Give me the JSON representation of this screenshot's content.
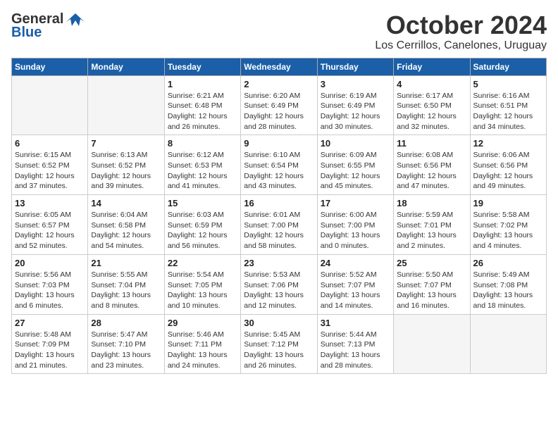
{
  "header": {
    "logo_general": "General",
    "logo_blue": "Blue",
    "title": "October 2024",
    "subtitle": "Los Cerrillos, Canelones, Uruguay"
  },
  "days_of_week": [
    "Sunday",
    "Monday",
    "Tuesday",
    "Wednesday",
    "Thursday",
    "Friday",
    "Saturday"
  ],
  "weeks": [
    [
      {
        "day": "",
        "content": ""
      },
      {
        "day": "",
        "content": ""
      },
      {
        "day": "1",
        "content": "Sunrise: 6:21 AM\nSunset: 6:48 PM\nDaylight: 12 hours and 26 minutes."
      },
      {
        "day": "2",
        "content": "Sunrise: 6:20 AM\nSunset: 6:49 PM\nDaylight: 12 hours and 28 minutes."
      },
      {
        "day": "3",
        "content": "Sunrise: 6:19 AM\nSunset: 6:49 PM\nDaylight: 12 hours and 30 minutes."
      },
      {
        "day": "4",
        "content": "Sunrise: 6:17 AM\nSunset: 6:50 PM\nDaylight: 12 hours and 32 minutes."
      },
      {
        "day": "5",
        "content": "Sunrise: 6:16 AM\nSunset: 6:51 PM\nDaylight: 12 hours and 34 minutes."
      }
    ],
    [
      {
        "day": "6",
        "content": "Sunrise: 6:15 AM\nSunset: 6:52 PM\nDaylight: 12 hours and 37 minutes."
      },
      {
        "day": "7",
        "content": "Sunrise: 6:13 AM\nSunset: 6:52 PM\nDaylight: 12 hours and 39 minutes."
      },
      {
        "day": "8",
        "content": "Sunrise: 6:12 AM\nSunset: 6:53 PM\nDaylight: 12 hours and 41 minutes."
      },
      {
        "day": "9",
        "content": "Sunrise: 6:10 AM\nSunset: 6:54 PM\nDaylight: 12 hours and 43 minutes."
      },
      {
        "day": "10",
        "content": "Sunrise: 6:09 AM\nSunset: 6:55 PM\nDaylight: 12 hours and 45 minutes."
      },
      {
        "day": "11",
        "content": "Sunrise: 6:08 AM\nSunset: 6:56 PM\nDaylight: 12 hours and 47 minutes."
      },
      {
        "day": "12",
        "content": "Sunrise: 6:06 AM\nSunset: 6:56 PM\nDaylight: 12 hours and 49 minutes."
      }
    ],
    [
      {
        "day": "13",
        "content": "Sunrise: 6:05 AM\nSunset: 6:57 PM\nDaylight: 12 hours and 52 minutes."
      },
      {
        "day": "14",
        "content": "Sunrise: 6:04 AM\nSunset: 6:58 PM\nDaylight: 12 hours and 54 minutes."
      },
      {
        "day": "15",
        "content": "Sunrise: 6:03 AM\nSunset: 6:59 PM\nDaylight: 12 hours and 56 minutes."
      },
      {
        "day": "16",
        "content": "Sunrise: 6:01 AM\nSunset: 7:00 PM\nDaylight: 12 hours and 58 minutes."
      },
      {
        "day": "17",
        "content": "Sunrise: 6:00 AM\nSunset: 7:00 PM\nDaylight: 13 hours and 0 minutes."
      },
      {
        "day": "18",
        "content": "Sunrise: 5:59 AM\nSunset: 7:01 PM\nDaylight: 13 hours and 2 minutes."
      },
      {
        "day": "19",
        "content": "Sunrise: 5:58 AM\nSunset: 7:02 PM\nDaylight: 13 hours and 4 minutes."
      }
    ],
    [
      {
        "day": "20",
        "content": "Sunrise: 5:56 AM\nSunset: 7:03 PM\nDaylight: 13 hours and 6 minutes."
      },
      {
        "day": "21",
        "content": "Sunrise: 5:55 AM\nSunset: 7:04 PM\nDaylight: 13 hours and 8 minutes."
      },
      {
        "day": "22",
        "content": "Sunrise: 5:54 AM\nSunset: 7:05 PM\nDaylight: 13 hours and 10 minutes."
      },
      {
        "day": "23",
        "content": "Sunrise: 5:53 AM\nSunset: 7:06 PM\nDaylight: 13 hours and 12 minutes."
      },
      {
        "day": "24",
        "content": "Sunrise: 5:52 AM\nSunset: 7:07 PM\nDaylight: 13 hours and 14 minutes."
      },
      {
        "day": "25",
        "content": "Sunrise: 5:50 AM\nSunset: 7:07 PM\nDaylight: 13 hours and 16 minutes."
      },
      {
        "day": "26",
        "content": "Sunrise: 5:49 AM\nSunset: 7:08 PM\nDaylight: 13 hours and 18 minutes."
      }
    ],
    [
      {
        "day": "27",
        "content": "Sunrise: 5:48 AM\nSunset: 7:09 PM\nDaylight: 13 hours and 21 minutes."
      },
      {
        "day": "28",
        "content": "Sunrise: 5:47 AM\nSunset: 7:10 PM\nDaylight: 13 hours and 23 minutes."
      },
      {
        "day": "29",
        "content": "Sunrise: 5:46 AM\nSunset: 7:11 PM\nDaylight: 13 hours and 24 minutes."
      },
      {
        "day": "30",
        "content": "Sunrise: 5:45 AM\nSunset: 7:12 PM\nDaylight: 13 hours and 26 minutes."
      },
      {
        "day": "31",
        "content": "Sunrise: 5:44 AM\nSunset: 7:13 PM\nDaylight: 13 hours and 28 minutes."
      },
      {
        "day": "",
        "content": ""
      },
      {
        "day": "",
        "content": ""
      }
    ]
  ]
}
